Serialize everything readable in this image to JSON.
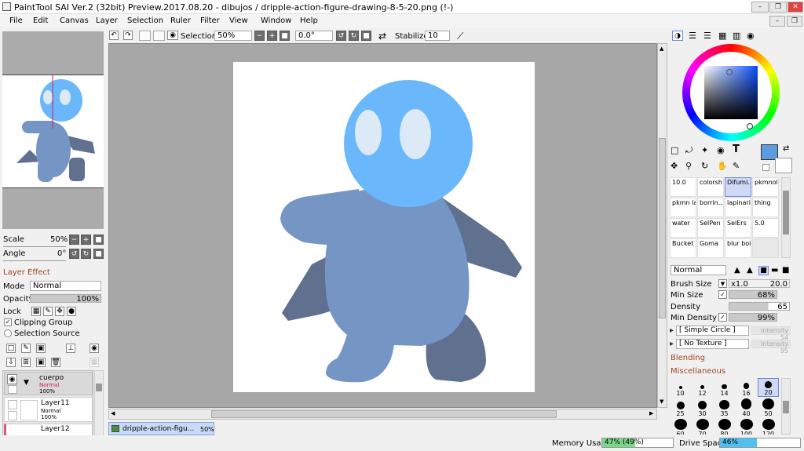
{
  "window": {
    "title": "PaintTool SAI Ver.2 (32bit) Preview.2017.08.20 - dibujos / dripple-action-figure-drawing-8-5-20.png (!-)"
  },
  "menu": [
    "File",
    "Edit",
    "Canvas",
    "Layer",
    "Selection",
    "Ruler",
    "Filter",
    "View",
    "Window",
    "Help"
  ],
  "toolbar": {
    "selection_label": "Selection",
    "zoom": "50%",
    "rotation": "0.0°",
    "stabilizer_label": "Stabilizer",
    "stabilizer_value": "10"
  },
  "navigator": {
    "scale_label": "Scale",
    "scale_value": "50%",
    "angle_label": "Angle",
    "angle_value": "0°"
  },
  "layer_effect": {
    "header": "Layer Effect",
    "mode_label": "Mode",
    "mode_value": "Normal",
    "opacity_label": "Opacity",
    "opacity_value": "100%",
    "lock_label": "Lock",
    "clipping_group": "Clipping Group",
    "selection_source": "Selection Source"
  },
  "layers": [
    {
      "name": "cuerpo",
      "mode": "Normal",
      "opacity": "100%"
    },
    {
      "name": "Layer11",
      "mode": "Normal",
      "opacity": "100%"
    },
    {
      "name": "Layer12"
    }
  ],
  "document_tab": {
    "name": "dripple-action-figu...",
    "zoom": "50%"
  },
  "status": {
    "memory_label": "Memory Usage",
    "memory_value": "47% (49%)",
    "memory_fraction": 0.47,
    "drive_label": "Drive Space",
    "drive_value": "46%",
    "drive_fraction": 0.46
  },
  "brushes": [
    {
      "name": "10.0"
    },
    {
      "name": "colorsh"
    },
    {
      "name": "Difumi..."
    },
    {
      "name": "pkmnold"
    },
    {
      "name": "pkmn lapz"
    },
    {
      "name": "borrin..."
    },
    {
      "name": "lapinario"
    },
    {
      "name": "thing"
    },
    {
      "name": "water"
    },
    {
      "name": "SelPen"
    },
    {
      "name": "SelErs"
    },
    {
      "name": "5.0"
    },
    {
      "name": "Bucket"
    },
    {
      "name": "Goma"
    },
    {
      "name": "blur boi"
    },
    {
      "name": ""
    }
  ],
  "brush_settings": {
    "blend_mode": "Normal",
    "size_label": "Brush Size",
    "size_mult": "x1.0",
    "size_value": "20.0",
    "min_size_label": "Min Size",
    "min_size_value": "68%",
    "density_label": "Density",
    "density_value": "65",
    "min_density_label": "Min Density",
    "min_density_value": "99%",
    "shape": "[ Simple Circle ]",
    "shape_intensity": "Intensity 54",
    "texture": "[ No Texture ]",
    "texture_intensity": "Intensity 95",
    "blending_label": "Blending",
    "misc_label": "Miscellaneous"
  },
  "brush_sizes": [
    "10",
    "12",
    "14",
    "16",
    "20",
    "25",
    "30",
    "35",
    "40",
    "50",
    "60",
    "70",
    "80",
    "100",
    "120"
  ],
  "colors": {
    "primary": "#5b9be0",
    "secondary": "#ffffff",
    "figure_head": "#6ab8fb",
    "figure_body": "#7596c5",
    "figure_dark": "#60708f",
    "eye": "#dce9f7"
  }
}
